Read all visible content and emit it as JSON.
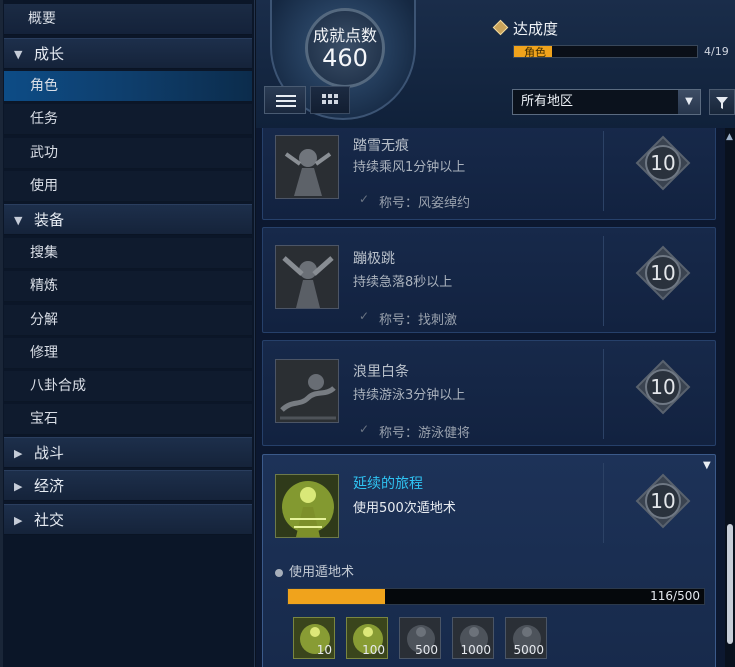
{
  "sidebar": {
    "items": [
      {
        "label": "概要",
        "type": "plain"
      },
      {
        "label": "成长",
        "type": "cat",
        "arrow": "▼"
      },
      {
        "label": "角色",
        "type": "sub",
        "selected": true
      },
      {
        "label": "任务",
        "type": "sub"
      },
      {
        "label": "武功",
        "type": "sub"
      },
      {
        "label": "使用",
        "type": "sub"
      },
      {
        "label": "装备",
        "type": "cat",
        "arrow": "▼"
      },
      {
        "label": "搜集",
        "type": "sub"
      },
      {
        "label": "精炼",
        "type": "sub"
      },
      {
        "label": "分解",
        "type": "sub"
      },
      {
        "label": "修理",
        "type": "sub"
      },
      {
        "label": "八卦合成",
        "type": "sub"
      },
      {
        "label": "宝石",
        "type": "sub"
      },
      {
        "label": "战斗",
        "type": "cat",
        "arrow": "▶"
      },
      {
        "label": "经济",
        "type": "cat",
        "arrow": "▶"
      },
      {
        "label": "社交",
        "type": "cat",
        "arrow": "▶"
      }
    ]
  },
  "header": {
    "points_title": "成就点数",
    "points_value": "460",
    "achievement_label": "达成度",
    "bar_label": "角色",
    "bar_count": "4/19",
    "bar_fraction": 0.21,
    "region_select": "所有地区",
    "dropdown_arrow": "▼"
  },
  "achievements": [
    {
      "name": "踏雪无痕",
      "desc": "持续乘风1分钟以上",
      "reward": "称号：风姿绰约",
      "points": "10",
      "check": "✓"
    },
    {
      "name": "蹦极跳",
      "desc": "持续急落8秒以上",
      "reward": "称号：找刺激",
      "points": "10",
      "check": "✓"
    },
    {
      "name": "浪里白条",
      "desc": "持续游泳3分钟以上",
      "reward": "称号：游泳健将",
      "points": "10",
      "check": "✓"
    },
    {
      "name": "延续的旅程",
      "desc": "使用500次遁地术",
      "points": "10",
      "active": true,
      "sub_requirement": "使用遁地术",
      "progress_text": "116/500",
      "progress_fraction": 0.232,
      "tiers": [
        "10",
        "100",
        "500",
        "1000",
        "5000"
      ]
    }
  ],
  "icons": {
    "expand": "▼",
    "scroll_up": "▲"
  },
  "colors": {
    "accent_orange": "#f0a31c",
    "active_title": "#2fc3f2",
    "selected_row": "#0d4c86"
  }
}
